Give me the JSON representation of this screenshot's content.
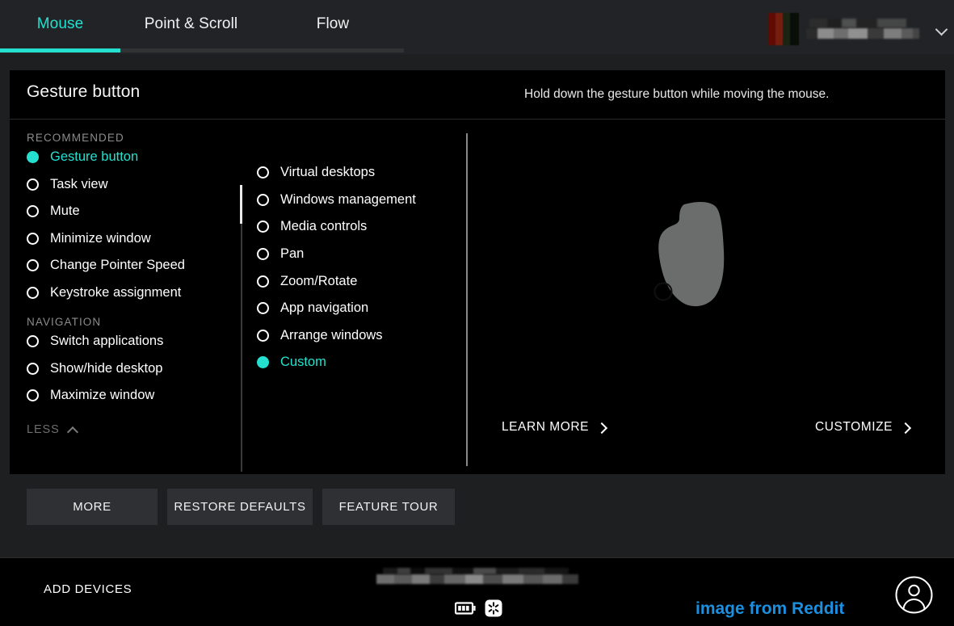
{
  "topbar": {
    "tabs": [
      {
        "label": "Mouse",
        "active": true
      },
      {
        "label": "Point & Scroll",
        "active": false
      },
      {
        "label": "Flow",
        "active": false
      }
    ],
    "account": {
      "name_redacted": "",
      "chevron_icon": "chevron-down-icon",
      "avatar_icon": "avatar-pixelated"
    }
  },
  "card": {
    "title": "Gesture button",
    "hint": "Hold down the gesture button while moving the mouse."
  },
  "sidebar": {
    "groups": [
      {
        "label": "RECOMMENDED",
        "items": [
          {
            "label": "Gesture button",
            "selected": true
          },
          {
            "label": "Task view",
            "selected": false
          },
          {
            "label": "Mute",
            "selected": false
          },
          {
            "label": "Minimize window",
            "selected": false
          },
          {
            "label": "Change Pointer Speed",
            "selected": false
          },
          {
            "label": "Keystroke assignment",
            "selected": false
          }
        ]
      },
      {
        "label": "NAVIGATION",
        "items": [
          {
            "label": "Switch applications",
            "selected": false
          },
          {
            "label": "Show/hide desktop",
            "selected": false
          },
          {
            "label": "Maximize window",
            "selected": false
          }
        ]
      }
    ],
    "less_label": "LESS",
    "less_icon": "chevron-up-icon"
  },
  "options": {
    "items": [
      {
        "label": "Virtual desktops",
        "selected": false
      },
      {
        "label": "Windows management",
        "selected": false
      },
      {
        "label": "Media controls",
        "selected": false
      },
      {
        "label": "Pan",
        "selected": false
      },
      {
        "label": "Zoom/Rotate",
        "selected": false
      },
      {
        "label": "App navigation",
        "selected": false
      },
      {
        "label": "Arrange windows",
        "selected": false
      },
      {
        "label": "Custom",
        "selected": true
      }
    ]
  },
  "preview": {
    "device_icon": "mouse-silhouette",
    "gesture_button_marker": "gesture-button-highlight",
    "learn_more_label": "LEARN MORE",
    "customize_label": "CUSTOMIZE",
    "chevron_icon": "chevron-right-icon"
  },
  "actions": [
    {
      "label": "MORE"
    },
    {
      "label": "RESTORE DEFAULTS"
    },
    {
      "label": "FEATURE TOUR"
    }
  ],
  "footer": {
    "add_devices_label": "ADD DEVICES",
    "device_name_redacted": "",
    "battery_icon": "battery-icon",
    "receiver_icon": "bolt-receiver-icon",
    "watermark": "image from Reddit",
    "account_icon": "account-circle-icon"
  },
  "colors": {
    "accent": "#25e0cf",
    "panel_bg": "#000000",
    "page_bg": "#1d1f21",
    "topbar_bg": "#212326",
    "button_bg": "#2e3033",
    "watermark": "#1b8fe0",
    "muted_text": "#8c8c8c"
  }
}
